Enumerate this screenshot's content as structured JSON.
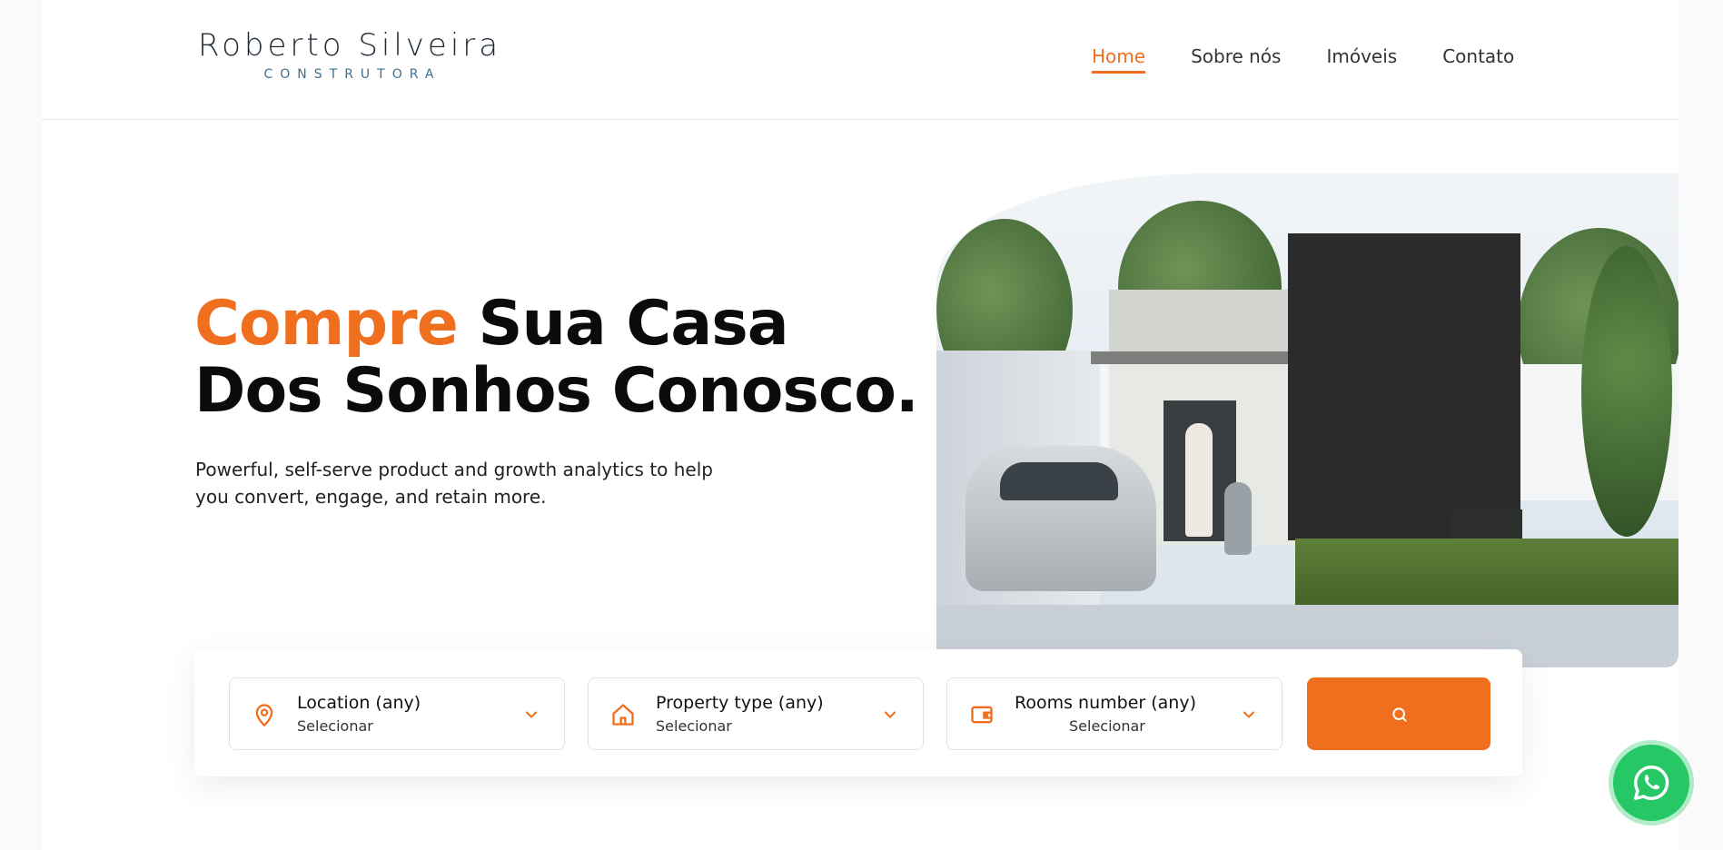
{
  "brand": {
    "name": "Roberto Silveira",
    "subtitle": "CONSTRUTORA"
  },
  "nav": {
    "items": [
      {
        "label": "Home",
        "active": true
      },
      {
        "label": "Sobre nós",
        "active": false
      },
      {
        "label": "Imóveis",
        "active": false
      },
      {
        "label": "Contato",
        "active": false
      }
    ]
  },
  "hero": {
    "title_accent": "Compre",
    "title_rest_line1": " Sua Casa",
    "title_line2": "Dos Sonhos Conosco.",
    "subtitle": "Powerful, self-serve product and growth analytics to help you convert, engage, and retain more.",
    "image_icon": "house-photo"
  },
  "search": {
    "fields": [
      {
        "label": "Location (any)",
        "value": "Selecionar",
        "icon": "map-pin-icon"
      },
      {
        "label": "Property type (any)",
        "value": "Selecionar",
        "icon": "home-icon"
      },
      {
        "label": "Rooms number (any)",
        "value": "Selecionar",
        "icon": "wallet-icon"
      }
    ],
    "button_icon": "search-icon"
  },
  "colors": {
    "accent": "#ef6f1f",
    "whatsapp": "#25c865",
    "text_dark": "#0b0b0b"
  },
  "floating": {
    "whatsapp_icon": "whatsapp-icon"
  }
}
